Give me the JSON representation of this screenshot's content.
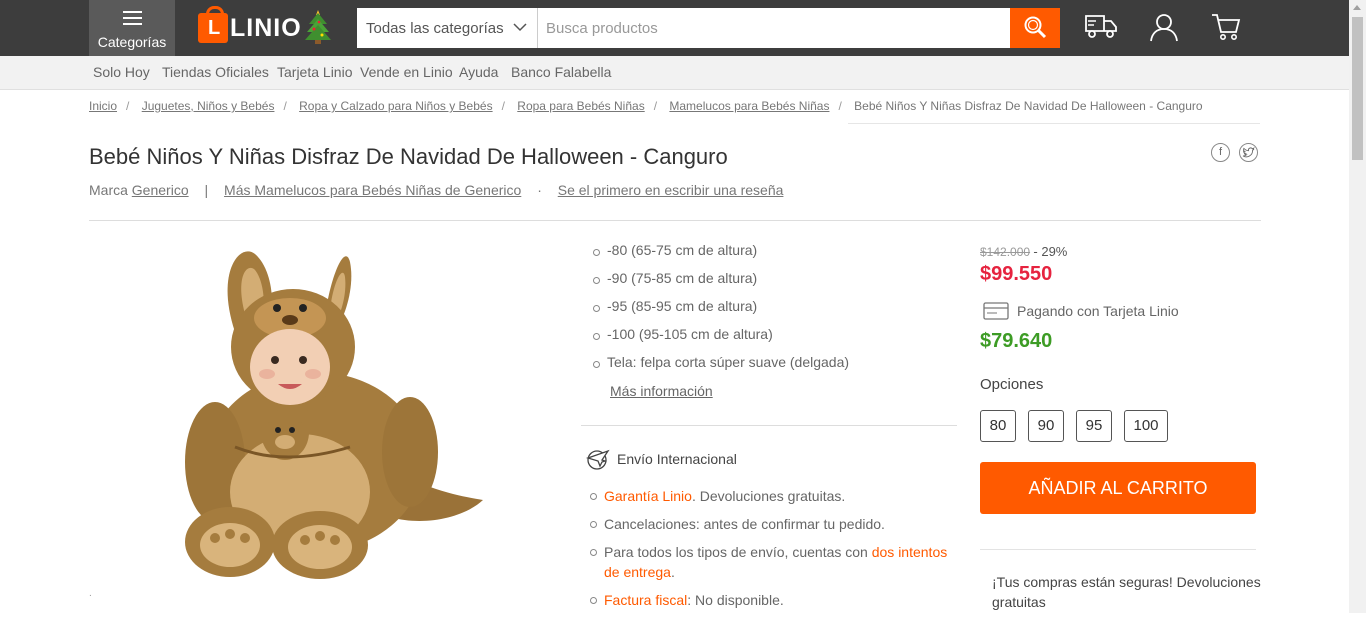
{
  "header": {
    "categories_label": "Categorías",
    "logo_text": "LINIO",
    "category_select": "Todas las categorías",
    "search_placeholder": "Busca productos"
  },
  "subnav": [
    "Solo Hoy",
    "Tiendas Oficiales",
    "Tarjeta Linio",
    "Vende en Linio",
    "Ayuda",
    "Banco Falabella"
  ],
  "breadcrumb": [
    "Inicio",
    "Juguetes, Niños y Bebés",
    "Ropa y Calzado para Niños y Bebés",
    "Ropa para Bebés Niñas",
    "Mamelucos para Bebés Niñas",
    "Bebé Niños Y Niñas Disfraz De Navidad De Halloween - Canguro"
  ],
  "product": {
    "title": "Bebé Niños Y Niñas Disfraz De Navidad De Halloween - Canguro",
    "brand_prefix": "Marca",
    "brand": "Generico",
    "more_link": "Más Mamelucos para Bebés Niñas de Generico",
    "review_link": "Se el primero en escribir una reseña",
    "features": [
      "-80 (65-75 cm de altura)",
      "-90 (75-85 cm de altura)",
      "-95 (85-95 cm de altura)",
      "-100 (95-105 cm de altura)",
      "Tela: felpa corta súper suave (delgada)"
    ],
    "more_info": "Más información"
  },
  "shipping": {
    "title": "Envío Internacional",
    "items": [
      {
        "link": "Garantía Linio",
        "text": ". Devoluciones gratuitas."
      },
      {
        "link": "",
        "text": "Cancelaciones: antes de confirmar tu pedido."
      },
      {
        "text": "Para todos los tipos de envío, cuentas con ",
        "link": "dos intentos de entrega",
        "after": "."
      },
      {
        "link": "Factura fiscal",
        "text": ": No disponible."
      }
    ]
  },
  "pricing": {
    "old_price": "$142.000",
    "discount": "- 29%",
    "price": "$99.550",
    "card_label": "Pagando con Tarjeta Linio",
    "card_price": "$79.640",
    "options_label": "Opciones",
    "options": [
      "80",
      "90",
      "95",
      "100"
    ],
    "add_to_cart": "AÑADIR AL CARRITO",
    "safe_text": "¡Tus compras están seguras! Devoluciones gratuitas"
  },
  "colors": {
    "accent": "#ff5a00",
    "price_red": "#e6233f",
    "price_green": "#3d9c25",
    "header_bg": "#3d3d3d"
  }
}
